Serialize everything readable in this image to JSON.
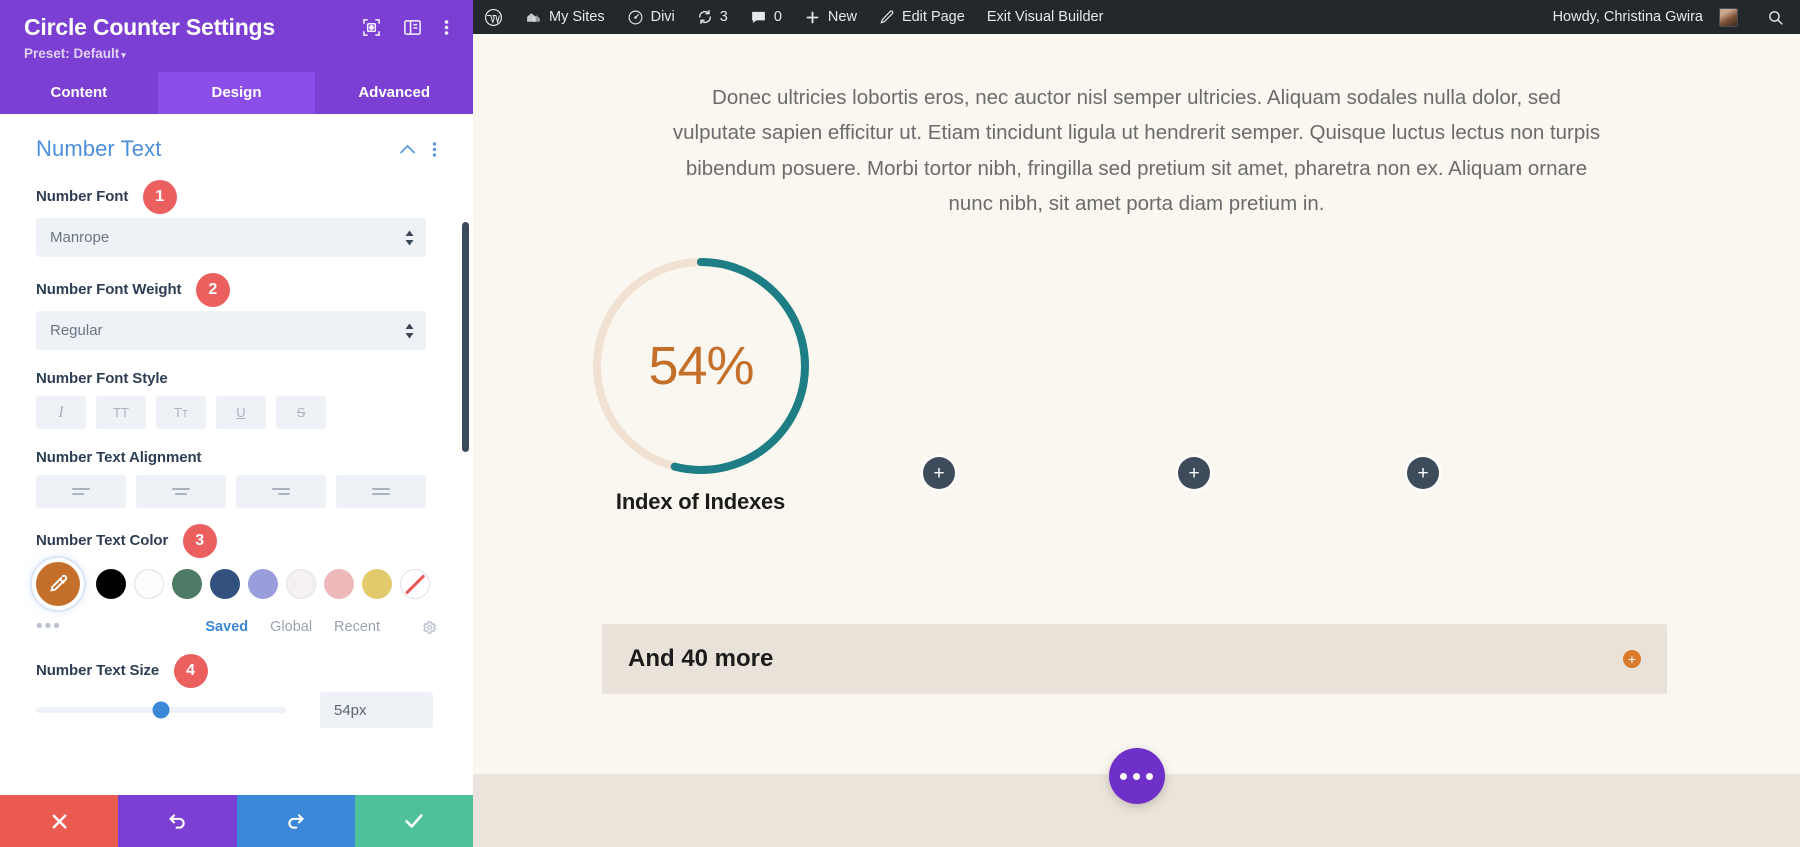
{
  "panel": {
    "title": "Circle Counter Settings",
    "preset_label": "Preset: Default",
    "preset_caret": "▾",
    "icons": {
      "focus": "focus-target-icon",
      "layout": "panel-layout-icon",
      "kebab": "more-options-icon"
    },
    "tabs": [
      {
        "label": "Content",
        "active": false
      },
      {
        "label": "Design",
        "active": true
      },
      {
        "label": "Advanced",
        "active": false
      }
    ],
    "section": {
      "title": "Number Text",
      "collapse_icon": "chevron-up-icon",
      "kebab_icon": "more-options-icon"
    },
    "fields": {
      "number_font": {
        "label": "Number Font",
        "badge": "1",
        "value": "Manrope"
      },
      "number_font_weight": {
        "label": "Number Font Weight",
        "badge": "2",
        "value": "Regular"
      },
      "number_font_style": {
        "label": "Number Font Style",
        "buttons": [
          {
            "glyph": "I",
            "name": "italic-button"
          },
          {
            "glyph": "TT",
            "name": "uppercase-button"
          },
          {
            "glyph": "Tᴛ",
            "name": "small-caps-button"
          },
          {
            "glyph": "U",
            "name": "underline-button"
          },
          {
            "glyph": "S",
            "name": "strikethrough-button"
          }
        ]
      },
      "number_text_alignment": {
        "label": "Number Text Alignment",
        "buttons": [
          "align-left",
          "align-center",
          "align-right",
          "align-justify"
        ]
      },
      "number_text_color": {
        "label": "Number Text Color",
        "badge": "3",
        "active_color": "#c4702a",
        "active_icon": "eyedropper-icon",
        "swatches": [
          {
            "hex": "#000000",
            "name": "swatch-black"
          },
          {
            "hex": "#fdfdfd",
            "name": "swatch-white"
          },
          {
            "hex": "#4d7a64",
            "name": "swatch-green"
          },
          {
            "hex": "#32517f",
            "name": "swatch-navy"
          },
          {
            "hex": "#9a9ddb",
            "name": "swatch-periwinkle"
          },
          {
            "hex": "#f5f1f2",
            "name": "swatch-offwhite"
          },
          {
            "hex": "#eeb9bb",
            "name": "swatch-pink"
          },
          {
            "hex": "#e3ca6d",
            "name": "swatch-yellow"
          },
          {
            "hex": "none",
            "name": "swatch-no-color"
          }
        ],
        "more_dots": "•••",
        "tabs": [
          {
            "label": "Saved",
            "active": true
          },
          {
            "label": "Global",
            "active": false
          },
          {
            "label": "Recent",
            "active": false
          }
        ],
        "gear_icon": "gear-icon"
      },
      "number_text_size": {
        "label": "Number Text Size",
        "badge": "4",
        "value": "54px",
        "slider_percent": 50
      }
    },
    "footer": [
      {
        "name": "cancel-button",
        "glyph": "✖"
      },
      {
        "name": "undo-button",
        "glyph": "↺"
      },
      {
        "name": "redo-button",
        "glyph": "↻"
      },
      {
        "name": "save-button",
        "glyph": "✔"
      }
    ]
  },
  "adminbar": {
    "items": [
      {
        "label": "",
        "icon": "wordpress-logo-icon",
        "name": "wp-logo"
      },
      {
        "label": "My Sites",
        "icon": "sites-icon",
        "name": "my-sites"
      },
      {
        "label": "Divi",
        "icon": "divi-icon",
        "name": "divi"
      },
      {
        "label": "3",
        "icon": "updates-icon",
        "name": "updates"
      },
      {
        "label": "0",
        "icon": "comments-icon",
        "name": "comments"
      },
      {
        "label": "New",
        "icon": "plus-icon",
        "name": "new"
      },
      {
        "label": "Edit Page",
        "icon": "pencil-icon",
        "name": "edit-page"
      },
      {
        "label": "Exit Visual Builder",
        "icon": "",
        "name": "exit-visual-builder"
      }
    ],
    "greeting": "Howdy, Christina Gwira",
    "search_icon": "search-icon"
  },
  "page": {
    "paragraph": "Donec ultricies lobortis eros, nec auctor nisl semper ultricies. Aliquam sodales nulla dolor, sed vulputate sapien efficitur ut. Etiam tincidunt ligula ut hendrerit semper. Quisque luctus lectus non turpis bibendum posuere. Morbi tortor nibh, fringilla sed pretium sit amet, pharetra non ex. Aliquam ornare nunc nibh, sit amet porta diam pretium in.",
    "counter": {
      "number": "54%",
      "percent": 54,
      "title": "Index of Indexes",
      "bar_color": "#1d7f85",
      "track_color": "#f0e1d3",
      "number_color": "#c4702a"
    },
    "add_buttons": [
      {
        "name": "add-module-button-1",
        "glyph": "+"
      },
      {
        "name": "add-module-button-2",
        "glyph": "+"
      },
      {
        "name": "add-module-button-3",
        "glyph": "+"
      }
    ],
    "more_bar": {
      "label": "And 40 more",
      "plus_glyph": "+",
      "accent": "#d97b2a"
    },
    "fab": {
      "name": "builder-menu-button",
      "icon": "ellipsis-icon"
    }
  }
}
